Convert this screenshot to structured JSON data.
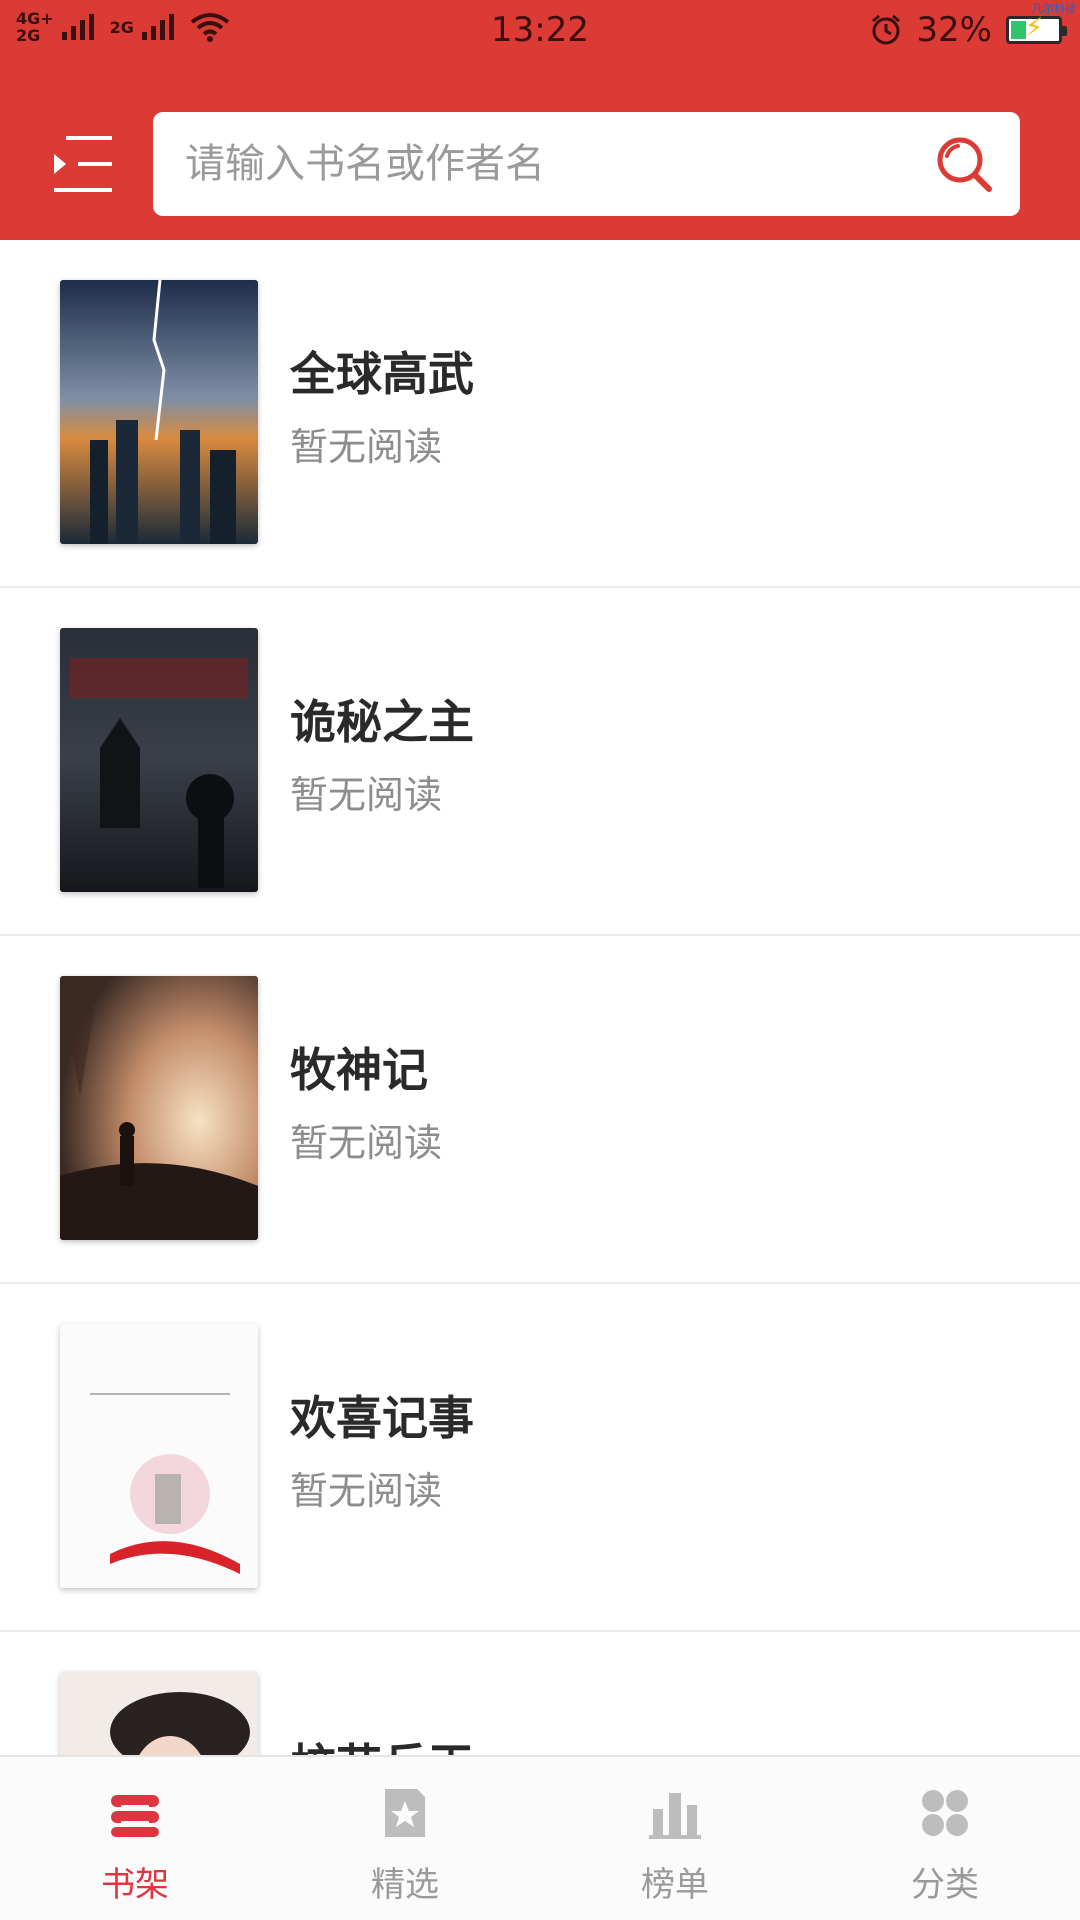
{
  "status_bar": {
    "network_label": "4G+ 2G",
    "network_label2": "2G",
    "time": "13:22",
    "battery_percent": "32%",
    "battery_level": 0.32,
    "corner_tag": "凡尔科技"
  },
  "header": {
    "menu_icon": "menu-icon",
    "search_placeholder": "请输入书名或作者名",
    "search_value": "",
    "search_icon": "search-icon",
    "accent_color": "#dc3a34"
  },
  "books": [
    {
      "title": "全球高武",
      "status": "暂无阅读"
    },
    {
      "title": "诡秘之主",
      "status": "暂无阅读"
    },
    {
      "title": "牧神记",
      "status": "暂无阅读"
    },
    {
      "title": "欢喜记事",
      "status": "暂无阅读"
    },
    {
      "title": "校花兵王",
      "status": ""
    }
  ],
  "tabs": [
    {
      "label": "书架",
      "icon": "bookshelf-icon",
      "active": true
    },
    {
      "label": "精选",
      "icon": "star-icon",
      "active": false
    },
    {
      "label": "榜单",
      "icon": "chart-icon",
      "active": false
    },
    {
      "label": "分类",
      "icon": "grid-icon",
      "active": false
    }
  ],
  "colors": {
    "active_tab": "#e0343e",
    "inactive_tab": "#bdbdbd"
  }
}
